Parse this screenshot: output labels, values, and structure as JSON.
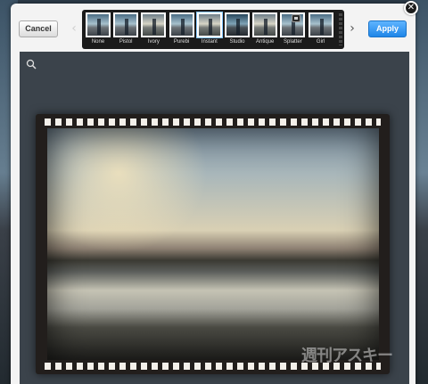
{
  "toolbar": {
    "cancel_label": "Cancel",
    "apply_label": "Apply",
    "close_symbol": "✕",
    "prev_symbol": "‹",
    "next_symbol": "›"
  },
  "filters": [
    {
      "name": "None",
      "tone": "cool"
    },
    {
      "name": "Pistol",
      "tone": "cool"
    },
    {
      "name": "Ivory",
      "tone": "warm"
    },
    {
      "name": "Purebi",
      "tone": "cool"
    },
    {
      "name": "Instant",
      "tone": "warm"
    },
    {
      "name": "Studio",
      "tone": "dark"
    },
    {
      "name": "Antique",
      "tone": "warm"
    },
    {
      "name": "Splatter",
      "tone": "cool"
    },
    {
      "name": "Girl",
      "tone": "cool"
    }
  ],
  "selected_filter": "Instant",
  "watermark": "週刊アスキー",
  "icons": {
    "zoom": "magnifier-icon",
    "strip_handle": "strip-handle-icon"
  },
  "colors": {
    "apply": "#1f86e8",
    "canvas": "#3b434b"
  }
}
